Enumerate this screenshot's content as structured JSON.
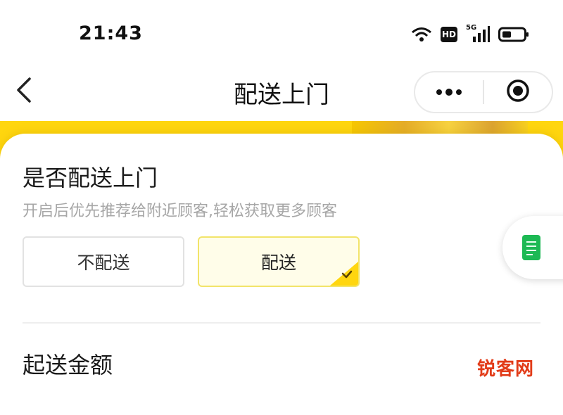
{
  "status_bar": {
    "time": "21:43",
    "hd_label": "HD",
    "network_label": "5G",
    "icons": [
      "wifi-icon",
      "hd-icon",
      "signal-icon",
      "battery-icon"
    ]
  },
  "nav": {
    "title": "配送上门",
    "back_icon": "chevron-left-icon",
    "more_icon": "more-dots-icon",
    "close_icon": "target-circle-icon"
  },
  "delivery": {
    "title": "是否配送上门",
    "subtitle": "开启后优先推荐给附近顾客,轻松获取更多顾客",
    "options": [
      {
        "label": "不配送",
        "selected": false
      },
      {
        "label": "配送",
        "selected": true
      }
    ]
  },
  "min_amount": {
    "title": "起送金额"
  },
  "float_button": {
    "icon": "document-icon"
  },
  "watermark": "锐客网",
  "colors": {
    "accent_yellow": "#ffd60f",
    "selected_bg": "#fffde9",
    "selected_border": "#f2e46a",
    "subtitle_gray": "#a7a7a7",
    "float_icon_green": "#1db954"
  }
}
